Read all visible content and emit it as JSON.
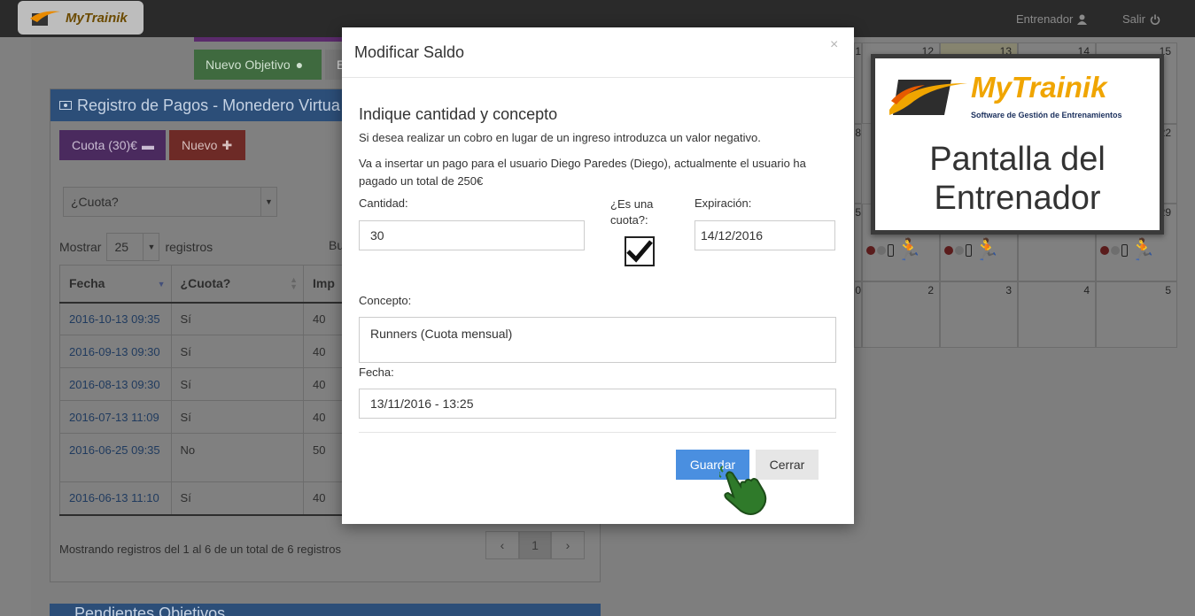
{
  "header": {
    "brand": "MyTrainik",
    "nav_trainer": "Entrenador",
    "nav_exit": "Salir"
  },
  "toolbar": {
    "new_goal_label": "Nuevo Objetivo",
    "grey_button_label": "E"
  },
  "payments_panel": {
    "title": "Registro de Pagos - Monedero Virtua",
    "fee_button": "Cuota (30)€",
    "new_button": "Nuevo",
    "filter_select": "¿Cuota?",
    "show_label": "Mostrar",
    "page_length": "25",
    "records_label": "registros",
    "search_label": "Bu",
    "columns": [
      "Fecha",
      "¿Cuota?",
      "Imp"
    ],
    "rows": [
      {
        "date": "2016-10-13 09:35",
        "fee": "Sí",
        "amount": "40"
      },
      {
        "date": "2016-09-13 09:30",
        "fee": "Sí",
        "amount": "40"
      },
      {
        "date": "2016-08-13 09:30",
        "fee": "Sí",
        "amount": "40"
      },
      {
        "date": "2016-07-13 11:09",
        "fee": "Sí",
        "amount": "40"
      },
      {
        "date": "2016-06-25 09:35",
        "fee": "No",
        "amount": "50"
      },
      {
        "date": "2016-06-13 11:10",
        "fee": "Sí",
        "amount": "40"
      }
    ],
    "info": "Mostrando registros del 1 al 6 de un total de 6 registros",
    "pager_prev": "‹",
    "pager_page": "1",
    "pager_next": "›"
  },
  "next_panel": {
    "title": "Pendientes Objetivos"
  },
  "calendar": {
    "row1": [
      "1",
      "12",
      "13",
      "14",
      "15"
    ],
    "row2": [
      "8",
      "22"
    ],
    "row3": [
      "5",
      "29"
    ],
    "row4": [
      "0",
      "2",
      "3",
      "4",
      "5"
    ]
  },
  "modal": {
    "title": "Modificar Saldo",
    "close": "×",
    "heading": "Indique cantidad y concepto",
    "note": "Si desea realizar un cobro en lugar de un ingreso introduzca un valor negativo.",
    "info": "Va a insertar un pago para el usuario Diego Paredes (Diego), actualmente el usuario ha pagado un total de 250€",
    "amount_label": "Cantidad:",
    "amount_value": "30",
    "is_fee_label_1": "¿Es una",
    "is_fee_label_2": "cuota?:",
    "is_fee_checked": true,
    "expiry_label": "Expiración:",
    "expiry_value": "14/12/2016",
    "concept_label": "Concepto:",
    "concept_value": "Runners (Cuota mensual)",
    "date_label": "Fecha:",
    "date_value": "13/11/2016 - 13:25",
    "save_button": "Guardar",
    "close_button": "Cerrar"
  },
  "promo": {
    "brand": "MyTrainik",
    "subtitle": "Software de Gestión de Entrenamientos",
    "title_line1": "Pantalla del",
    "title_line2": "Entrenador"
  },
  "colors": {
    "primary": "#4a8fe0",
    "brand_orange": "#f0a500",
    "brand_navy": "#1a2f5c"
  }
}
